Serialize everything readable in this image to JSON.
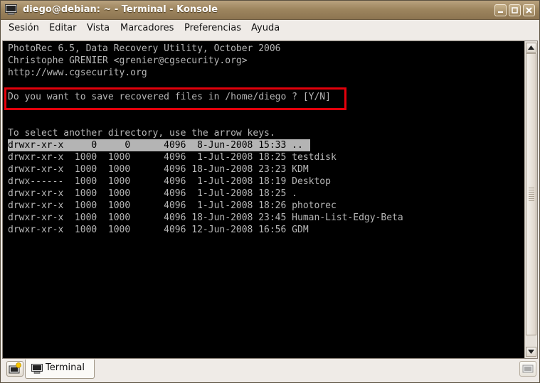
{
  "window": {
    "title": "diego@debian: ~ - Terminal - Konsole",
    "icons": {
      "app": "terminal-icon",
      "minimize": "minimize-icon",
      "maximize": "maximize-icon",
      "close": "close-icon"
    }
  },
  "menubar": {
    "items": [
      {
        "label": "Sesión"
      },
      {
        "label": "Editar"
      },
      {
        "label": "Vista"
      },
      {
        "label": "Marcadores"
      },
      {
        "label": "Preferencias"
      },
      {
        "label": "Ayuda"
      }
    ]
  },
  "terminal": {
    "lines": [
      "PhotoRec 6.5, Data Recovery Utility, October 2006",
      "Christophe GRENIER <grenier@cgsecurity.org>",
      "http://www.cgsecurity.org",
      "",
      "Do you want to save recovered files in /home/diego ? [Y/N]",
      "",
      "",
      "To select another directory, use the arrow keys.",
      "drwxr-xr-x     0     0      4096  8-Jun-2008 15:33 ..",
      "drwxr-xr-x  1000  1000      4096  1-Jul-2008 18:25 testdisk",
      "drwxr-xr-x  1000  1000      4096 18-Jun-2008 23:23 KDM",
      "drwx------  1000  1000      4096  1-Jul-2008 18:19 Desktop",
      "drwxr-xr-x  1000  1000      4096  1-Jul-2008 18:25 .",
      "drwxr-xr-x  1000  1000      4096  1-Jul-2008 18:26 photorec",
      "drwxr-xr-x  1000  1000      4096 18-Jun-2008 23:45 Human-List-Edgy-Beta",
      "drwxr-xr-x  1000  1000      4096 12-Jun-2008 16:56 GDM"
    ],
    "selected_line": 8,
    "highlight_color": "#e4000b",
    "text_color": "#b6b6b6",
    "background": "#000000"
  },
  "tabbar": {
    "tabs": [
      {
        "label": "Terminal",
        "icon": "terminal-icon"
      }
    ],
    "new_tab_icon": "new-session-icon",
    "close_tab_icon": "close-session-icon"
  }
}
